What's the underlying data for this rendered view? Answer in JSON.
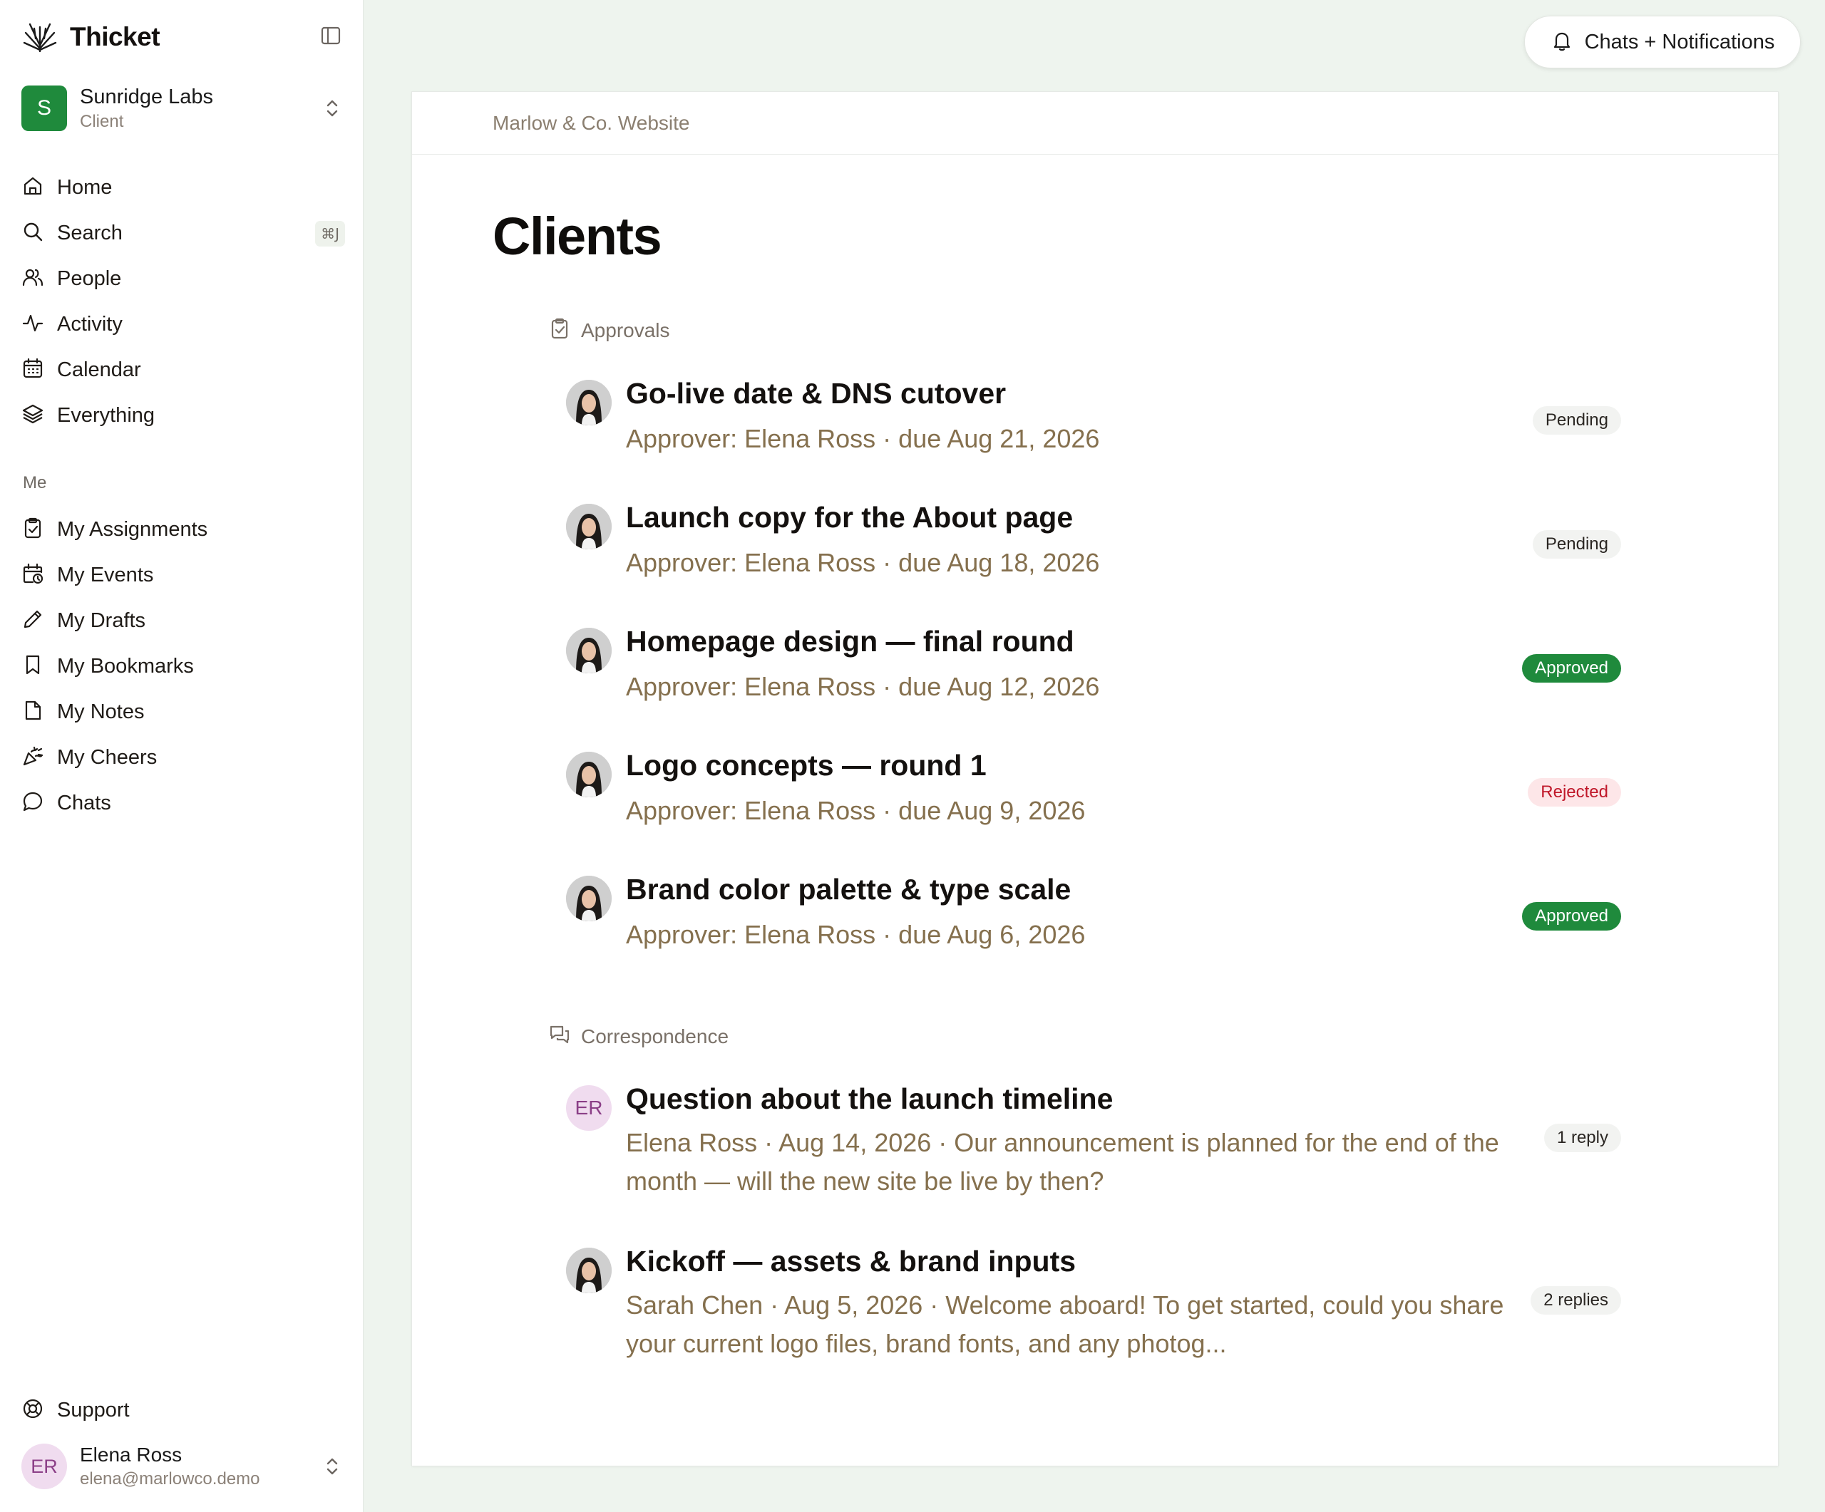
{
  "app": {
    "name": "Thicket"
  },
  "workspace": {
    "initial": "S",
    "name": "Sunridge Labs",
    "role": "Client"
  },
  "nav": [
    {
      "label": "Home",
      "icon": "home-icon"
    },
    {
      "label": "Search",
      "icon": "search-icon",
      "shortcut": "⌘J"
    },
    {
      "label": "People",
      "icon": "people-icon"
    },
    {
      "label": "Activity",
      "icon": "activity-icon"
    },
    {
      "label": "Calendar",
      "icon": "calendar-icon"
    },
    {
      "label": "Everything",
      "icon": "layers-icon"
    }
  ],
  "me_section": {
    "label": "Me",
    "items": [
      {
        "label": "My Assignments",
        "icon": "clipboard-check-icon"
      },
      {
        "label": "My Events",
        "icon": "calendar-clock-icon"
      },
      {
        "label": "My Drafts",
        "icon": "pencil-icon"
      },
      {
        "label": "My Bookmarks",
        "icon": "bookmark-icon"
      },
      {
        "label": "My Notes",
        "icon": "note-icon"
      },
      {
        "label": "My Cheers",
        "icon": "party-popper-icon"
      },
      {
        "label": "Chats",
        "icon": "chat-bubble-icon"
      }
    ]
  },
  "support": {
    "label": "Support",
    "icon": "lifebuoy-icon"
  },
  "user": {
    "initials": "ER",
    "name": "Elena Ross",
    "email": "elena@marlowco.demo"
  },
  "top": {
    "notifications_label": "Chats + Notifications"
  },
  "main": {
    "breadcrumb": "Marlow & Co. Website",
    "title": "Clients",
    "approvals": {
      "label": "Approvals",
      "items": [
        {
          "title": "Go-live date & DNS cutover",
          "subtitle": "Approver: Elena Ross · due Aug 21, 2026",
          "status": "Pending"
        },
        {
          "title": "Launch copy for the About page",
          "subtitle": "Approver: Elena Ross · due Aug 18, 2026",
          "status": "Pending"
        },
        {
          "title": "Homepage design — final round",
          "subtitle": "Approver: Elena Ross · due Aug 12, 2026",
          "status": "Approved"
        },
        {
          "title": "Logo concepts — round 1",
          "subtitle": "Approver: Elena Ross · due Aug 9, 2026",
          "status": "Rejected"
        },
        {
          "title": "Brand color palette & type scale",
          "subtitle": "Approver: Elena Ross · due Aug 6, 2026",
          "status": "Approved"
        }
      ]
    },
    "correspondence": {
      "label": "Correspondence",
      "items": [
        {
          "initials": "ER",
          "title": "Question about the launch timeline",
          "subtitle": "Elena Ross · Aug 14, 2026 · Our announcement is planned for the end of the month — will the new site be live by then?",
          "replies": "1 reply"
        },
        {
          "title": "Kickoff — assets & brand inputs",
          "subtitle": "Sarah Chen · Aug 5, 2026 · Welcome aboard! To get started, could you share your current logo files, brand fonts, and any photog...",
          "replies": "2 replies"
        }
      ]
    }
  }
}
